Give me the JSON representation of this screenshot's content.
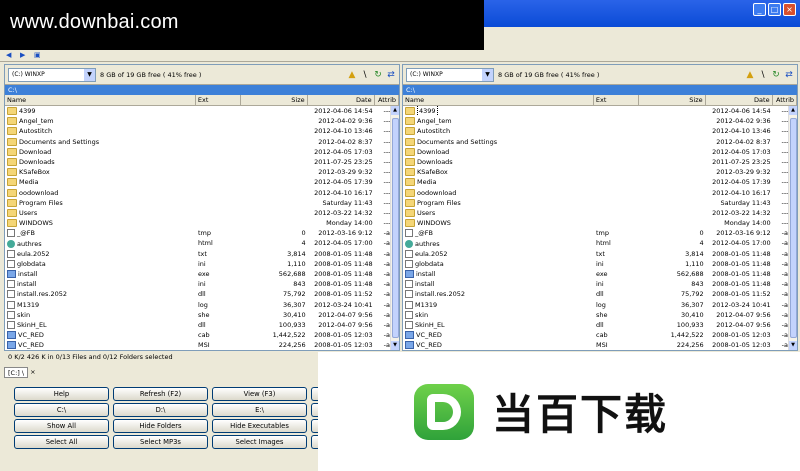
{
  "watermark_top": "www.downbai.com",
  "logo_text": "当百下载",
  "window_buttons": [
    "_",
    "□",
    "×"
  ],
  "panels": [
    {
      "drive_label": "(C:) WINXP",
      "free_text": "8 GB of 19 GB free ( 41% free )",
      "path": "C:\\",
      "columns": {
        "name": "Name",
        "ext": "Ext",
        "size": "Size",
        "date": "Date",
        "attrib": "Attrib"
      }
    },
    {
      "drive_label": "(C:) WINXP",
      "free_text": "8 GB of 19 GB free ( 41% free )",
      "path": "C:\\",
      "columns": {
        "name": "Name",
        "ext": "Ext",
        "size": "Size",
        "date": "Date",
        "attrib": "Attrib"
      }
    }
  ],
  "files": [
    {
      "name": "4399",
      "ext": "",
      "size": "",
      "date": "2012-04-06 14:54",
      "attrib": "----d",
      "icon": "folder"
    },
    {
      "name": "Angel_tem",
      "ext": "",
      "size": "",
      "date": "2012-04-02 9:36",
      "attrib": "----d",
      "icon": "folder"
    },
    {
      "name": "Autostitch",
      "ext": "",
      "size": "",
      "date": "2012-04-10 13:46",
      "attrib": "----d",
      "icon": "folder"
    },
    {
      "name": "Documents and Settings",
      "ext": "",
      "size": "",
      "date": "2012-04-02 8:37",
      "attrib": "----d",
      "icon": "folder"
    },
    {
      "name": "Download",
      "ext": "",
      "size": "",
      "date": "2012-04-05 17:03",
      "attrib": "----d",
      "icon": "folder"
    },
    {
      "name": "Downloads",
      "ext": "",
      "size": "",
      "date": "2011-07-25 23:25",
      "attrib": "----d",
      "icon": "folder"
    },
    {
      "name": "KSafeBox",
      "ext": "",
      "size": "",
      "date": "2012-03-29 9:32",
      "attrib": "----d",
      "icon": "folder"
    },
    {
      "name": "Media",
      "ext": "",
      "size": "",
      "date": "2012-04-05 17:39",
      "attrib": "----d",
      "icon": "folder"
    },
    {
      "name": "oodownload",
      "ext": "",
      "size": "",
      "date": "2012-04-10 16:17",
      "attrib": "----d",
      "icon": "folder"
    },
    {
      "name": "Program Files",
      "ext": "",
      "size": "",
      "date": "Saturday 11:43",
      "attrib": "----d",
      "icon": "folder"
    },
    {
      "name": "Users",
      "ext": "",
      "size": "",
      "date": "2012-03-22 14:32",
      "attrib": "----d",
      "icon": "folder"
    },
    {
      "name": "WINDOWS",
      "ext": "",
      "size": "",
      "date": "Monday 14:00",
      "attrib": "----d",
      "icon": "folder"
    },
    {
      "name": "_@FB",
      "ext": "tmp",
      "size": "0",
      "date": "2012-03-16 9:12",
      "attrib": "-a---",
      "icon": "file"
    },
    {
      "name": "authres",
      "ext": "html",
      "size": "4",
      "date": "2012-04-05 17:00",
      "attrib": "-a---",
      "icon": "html"
    },
    {
      "name": "eula.2052",
      "ext": "txt",
      "size": "3,814",
      "date": "2008-01-05 11:48",
      "attrib": "-a---",
      "icon": "file"
    },
    {
      "name": "globdata",
      "ext": "ini",
      "size": "1,110",
      "date": "2008-01-05 11:48",
      "attrib": "-a---",
      "icon": "file"
    },
    {
      "name": "install",
      "ext": "exe",
      "size": "562,688",
      "date": "2008-01-05 11:48",
      "attrib": "-a---",
      "icon": "exe"
    },
    {
      "name": "install",
      "ext": "ini",
      "size": "843",
      "date": "2008-01-05 11:48",
      "attrib": "-a---",
      "icon": "file"
    },
    {
      "name": "install.res.2052",
      "ext": "dll",
      "size": "75,792",
      "date": "2008-01-05 11:52",
      "attrib": "-a---",
      "icon": "file"
    },
    {
      "name": "M1319",
      "ext": "log",
      "size": "36,307",
      "date": "2012-03-24 10:41",
      "attrib": "-a---",
      "icon": "file"
    },
    {
      "name": "skin",
      "ext": "she",
      "size": "30,410",
      "date": "2012-04-07 9:56",
      "attrib": "-a---",
      "icon": "file"
    },
    {
      "name": "SkinH_EL",
      "ext": "dll",
      "size": "100,933",
      "date": "2012-04-07 9:56",
      "attrib": "-a---",
      "icon": "file"
    },
    {
      "name": "VC_RED",
      "ext": "cab",
      "size": "1,442,522",
      "date": "2008-01-05 12:03",
      "attrib": "-a---",
      "icon": "exe"
    },
    {
      "name": "VC_RED",
      "ext": "MSI",
      "size": "224,256",
      "date": "2008-01-05 12:03",
      "attrib": "-a---",
      "icon": "exe"
    }
  ],
  "status_text": "0 K/2 426 K in 0/13 Files and 0/12 Folders selected",
  "drive_tab": "[C:] \\",
  "drive_tab_close": "×",
  "buttons": [
    [
      "Help",
      "Refresh (F2)",
      "View (F3)"
    ],
    [
      "C:\\",
      "D:\\",
      "E:\\"
    ],
    [
      "Show All",
      "Hide Folders",
      "Hide Executables"
    ],
    [
      "Select All",
      "Select MP3s",
      "Select Images"
    ]
  ]
}
